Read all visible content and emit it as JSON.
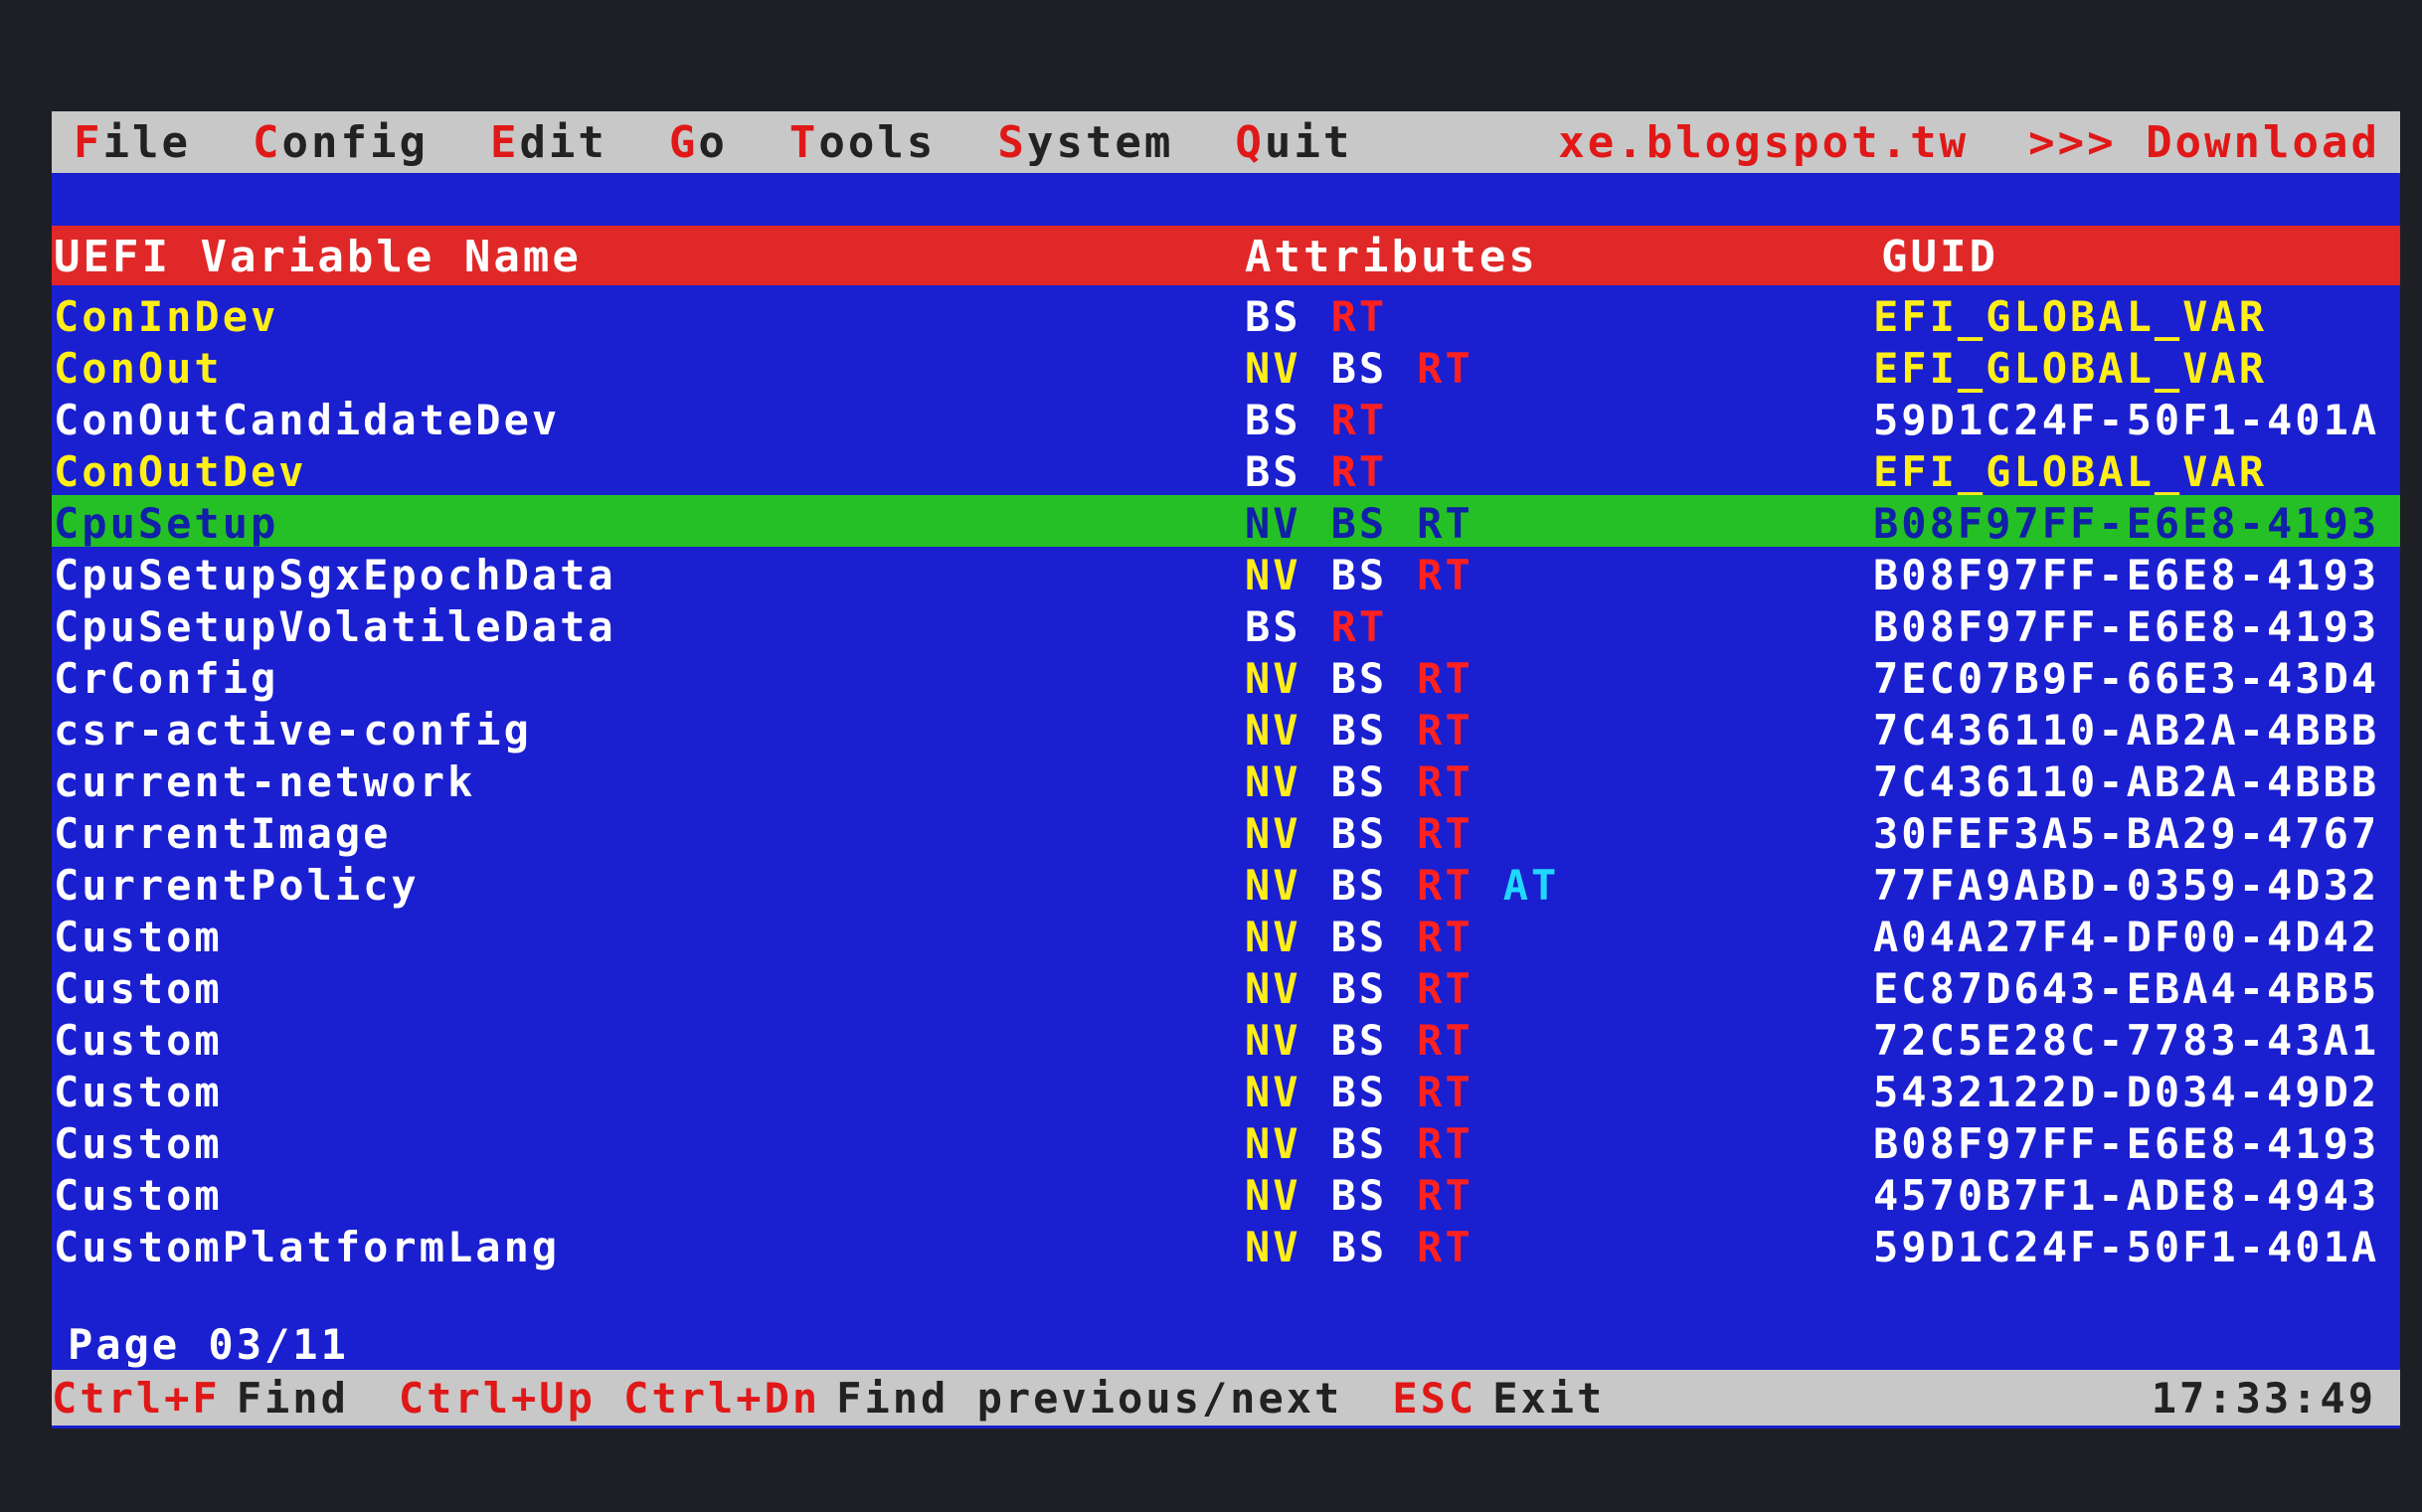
{
  "menu": [
    {
      "hot": "F",
      "rest": "ile"
    },
    {
      "hot": "C",
      "rest": "onfig"
    },
    {
      "hot": "E",
      "rest": "dit"
    },
    {
      "hot": "G",
      "rest": "o"
    },
    {
      "hot": "T",
      "rest": "ools"
    },
    {
      "hot": "S",
      "rest": "ystem"
    },
    {
      "hot": "Q",
      "rest": "uit"
    }
  ],
  "site": "xe.blogspot.tw",
  "download": ">>> Download",
  "header": {
    "name": "UEFI Variable Name",
    "attributes": "Attributes",
    "guid": "GUID"
  },
  "rows": [
    {
      "name": "ConInDev",
      "attrs": [
        "BS",
        "RT"
      ],
      "guid": "EFI_GLOBAL_VAR",
      "highlight": true
    },
    {
      "name": "ConOut",
      "attrs": [
        "NV",
        "BS",
        "RT"
      ],
      "guid": "EFI_GLOBAL_VAR",
      "highlight": true
    },
    {
      "name": "ConOutCandidateDev",
      "attrs": [
        "BS",
        "RT"
      ],
      "guid": "59D1C24F-50F1-401A",
      "highlight": false
    },
    {
      "name": "ConOutDev",
      "attrs": [
        "BS",
        "RT"
      ],
      "guid": "EFI_GLOBAL_VAR",
      "highlight": true
    },
    {
      "name": "CpuSetup",
      "attrs": [
        "NV",
        "BS",
        "RT"
      ],
      "guid": "B08F97FF-E6E8-4193",
      "highlight": false,
      "selected": true
    },
    {
      "name": "CpuSetupSgxEpochData",
      "attrs": [
        "NV",
        "BS",
        "RT"
      ],
      "guid": "B08F97FF-E6E8-4193",
      "highlight": false
    },
    {
      "name": "CpuSetupVolatileData",
      "attrs": [
        "BS",
        "RT"
      ],
      "guid": "B08F97FF-E6E8-4193",
      "highlight": false
    },
    {
      "name": "CrConfig",
      "attrs": [
        "NV",
        "BS",
        "RT"
      ],
      "guid": "7EC07B9F-66E3-43D4",
      "highlight": false
    },
    {
      "name": "csr-active-config",
      "attrs": [
        "NV",
        "BS",
        "RT"
      ],
      "guid": "7C436110-AB2A-4BBB",
      "highlight": false
    },
    {
      "name": "current-network",
      "attrs": [
        "NV",
        "BS",
        "RT"
      ],
      "guid": "7C436110-AB2A-4BBB",
      "highlight": false
    },
    {
      "name": "CurrentImage",
      "attrs": [
        "NV",
        "BS",
        "RT"
      ],
      "guid": "30FEF3A5-BA29-4767",
      "highlight": false
    },
    {
      "name": "CurrentPolicy",
      "attrs": [
        "NV",
        "BS",
        "RT",
        "AT"
      ],
      "guid": "77FA9ABD-0359-4D32",
      "highlight": false
    },
    {
      "name": "Custom",
      "attrs": [
        "NV",
        "BS",
        "RT"
      ],
      "guid": "A04A27F4-DF00-4D42",
      "highlight": false
    },
    {
      "name": "Custom",
      "attrs": [
        "NV",
        "BS",
        "RT"
      ],
      "guid": "EC87D643-EBA4-4BB5",
      "highlight": false
    },
    {
      "name": "Custom",
      "attrs": [
        "NV",
        "BS",
        "RT"
      ],
      "guid": "72C5E28C-7783-43A1",
      "highlight": false
    },
    {
      "name": "Custom",
      "attrs": [
        "NV",
        "BS",
        "RT"
      ],
      "guid": "5432122D-D034-49D2",
      "highlight": false
    },
    {
      "name": "Custom",
      "attrs": [
        "NV",
        "BS",
        "RT"
      ],
      "guid": "B08F97FF-E6E8-4193",
      "highlight": false
    },
    {
      "name": "Custom",
      "attrs": [
        "NV",
        "BS",
        "RT"
      ],
      "guid": "4570B7F1-ADE8-4943",
      "highlight": false
    },
    {
      "name": "CustomPlatformLang",
      "attrs": [
        "NV",
        "BS",
        "RT"
      ],
      "guid": "59D1C24F-50F1-401A",
      "highlight": false
    }
  ],
  "page": "Page 03/11",
  "status": [
    {
      "key": "Ctrl+F",
      "desc": "Find"
    },
    {
      "key": "Ctrl+Up Ctrl+Dn",
      "desc": "Find previous/next"
    },
    {
      "key": "ESC",
      "desc": "Exit"
    }
  ],
  "clock": "17:33:49",
  "colors": {
    "background": "#1a1fd0",
    "header": "#e02828",
    "selected_row": "#25c025",
    "bar": "#c8c8c8",
    "name_highlight": "#ffee18",
    "attr_nv": "#ffee18",
    "attr_bs": "#ffffff",
    "attr_rt": "#ff2020",
    "attr_at": "#20d8ff"
  }
}
